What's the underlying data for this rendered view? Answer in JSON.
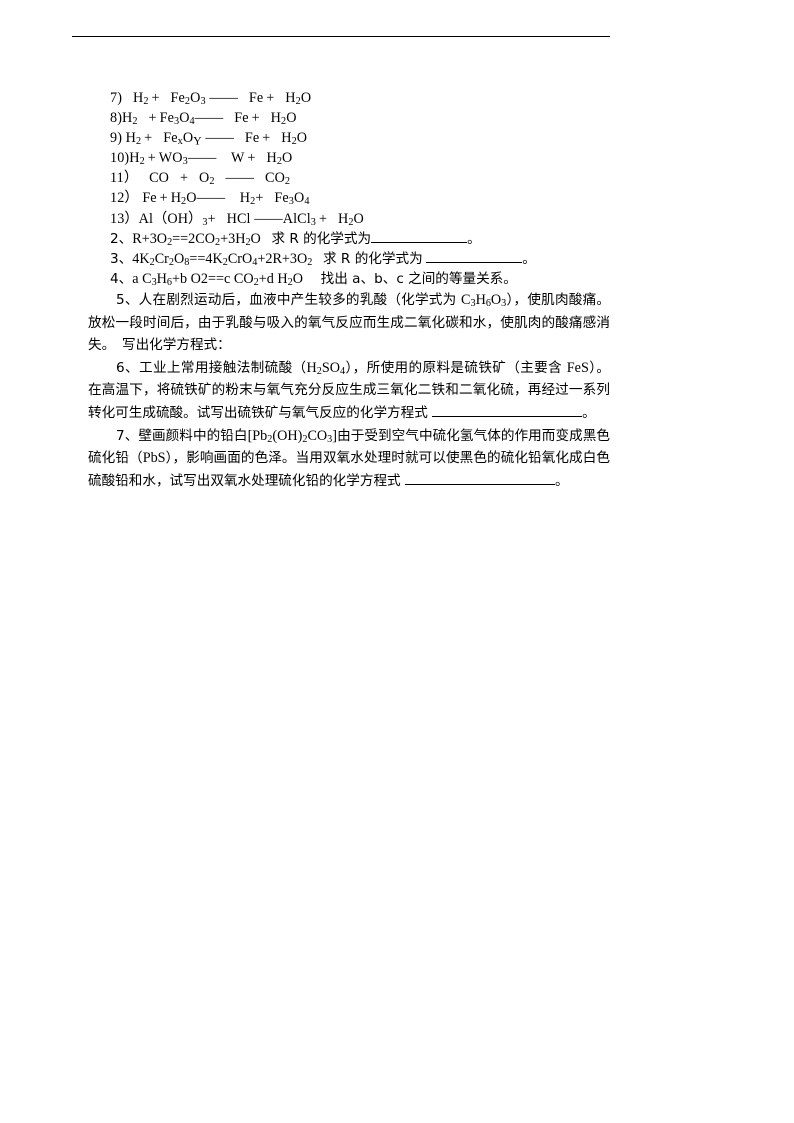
{
  "document": {
    "type": "chemistry-worksheet",
    "language": "zh-CN",
    "header_rule": true
  },
  "equations": [
    {
      "num": "7）",
      "body": "H₂＋  Fe₂O₃ －－   Fe＋  H₂O"
    },
    {
      "num": "8)",
      "body": "H₂  ＋Fe₃O₄－－   Fe＋  H₂O"
    },
    {
      "num": "9）",
      "body": "H₂＋   FeₓO_Y －－   Fe＋  H₂O"
    },
    {
      "num": "10)",
      "body": "H₂＋WO₃－－   W＋  H₂O"
    },
    {
      "num": "11）",
      "body": "CO  ＋  O₂  －－  CO₂"
    },
    {
      "num": "12）",
      "body": "Fe＋H₂O－－   H₂＋  Fe₃O₄"
    },
    {
      "num": "13）",
      "body": "Al（OH）₃＋  HCl －－AlCl₃＋  H₂O"
    }
  ],
  "questions": [
    {
      "num": "2、",
      "formula": "R+3O₂==2CO₂+3H₂O",
      "prompt": "求 R 的化学式为",
      "blank": true,
      "end": "。"
    },
    {
      "num": "3、",
      "formula": "4K₂Cr₂O₈==4K₂CrO₄+2R+3O₂",
      "prompt": "求 R 的化学式为",
      "blank": true,
      "end": "。"
    },
    {
      "num": "4、",
      "formula": "a C₃H₆+b O2==c CO₂+d H₂O",
      "prompt": "找出 a、b、c 之间的等量关系。",
      "blank": false,
      "end": ""
    }
  ],
  "paragraphs": [
    {
      "id": "q5",
      "text_parts": [
        "5、人在剧烈运动后，血液中产生较多的乳酸（化学式为 ",
        "C₃H₆O₃",
        "），使肌肉酸痛。放松一段时间后，由于乳酸与吸入的氧气反应而生成二氧化碳和水，使肌肉的酸痛感消失。　写出化学方程式："
      ]
    },
    {
      "id": "q6",
      "text_parts": [
        "6、工业上常用接触法制硫酸（",
        "H₂SO₄",
        "），所使用的原料是硫铁矿（主要含 ",
        "FeS",
        "）。在高温下，将硫铁矿的粉末与氧气充分反应生成三氧化二铁和二氧化硫，再经过一系列转化可生成硫酸。试写出硫铁矿与氧气反应的化学方程式 "
      ],
      "blank": true,
      "end": "。"
    },
    {
      "id": "q7",
      "text_parts": [
        "7、壁画颜料中的铅白",
        "[Pb₂(OH)₂CO₃]",
        "由于受到空气中硫化氢气体的作用而变成黑色硫化铅（",
        "PbS",
        "），影响画面的色泽。当用双氧水处理时就可以使黑色的硫化铅氧化成白色硫酸铅和水，试写出双氧水处理硫化铅的化学方程式 "
      ],
      "blank": true,
      "end": "。"
    }
  ]
}
